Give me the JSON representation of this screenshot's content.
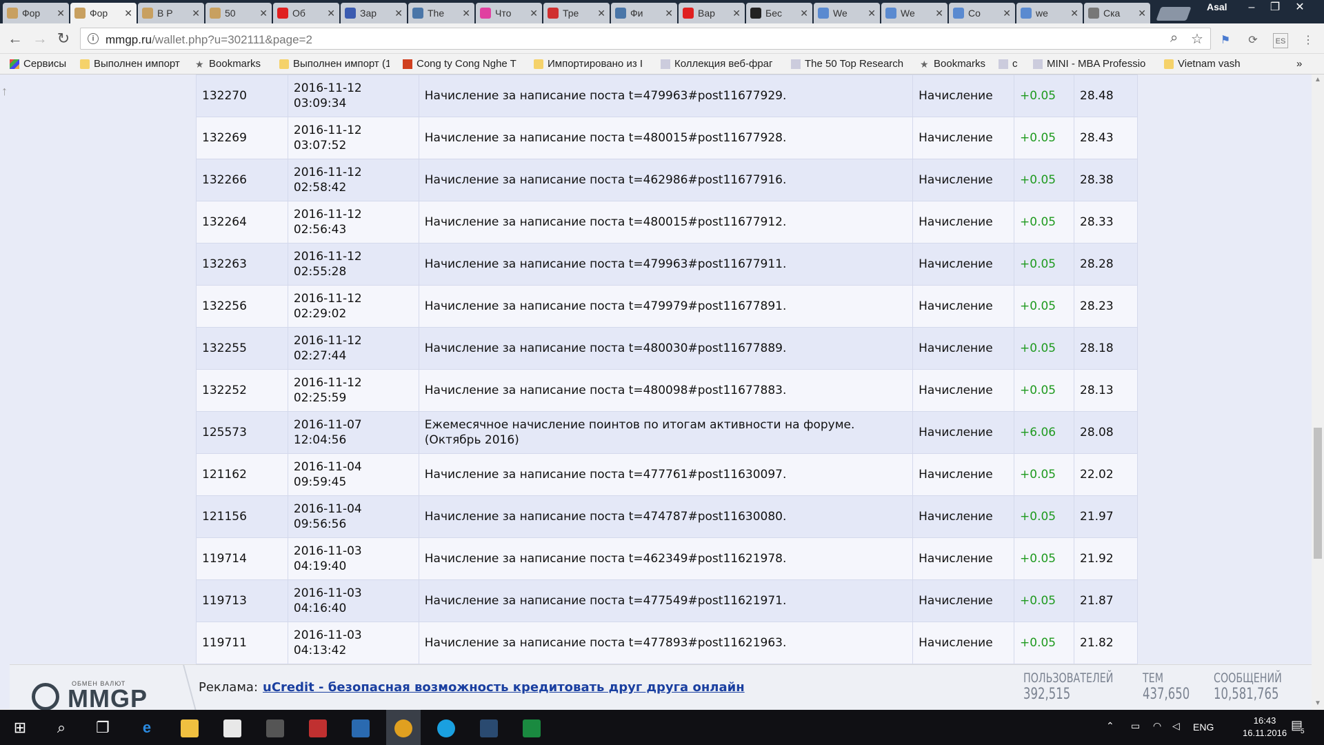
{
  "tabs": [
    {
      "label": "Фор",
      "favicon_color": "#c8a060"
    },
    {
      "label": "Фор",
      "favicon_color": "#c8a060",
      "active": true
    },
    {
      "label": "В Р",
      "favicon_color": "#c8a060"
    },
    {
      "label": "50",
      "favicon_color": "#c8a060"
    },
    {
      "label": "Об",
      "favicon_color": "#e02020"
    },
    {
      "label": "Зар",
      "favicon_color": "#3b5bb0"
    },
    {
      "label": "The",
      "favicon_color": "#4a76a8"
    },
    {
      "label": "Что",
      "favicon_color": "#e040a0"
    },
    {
      "label": "Тре",
      "favicon_color": "#d03030"
    },
    {
      "label": "Фи",
      "favicon_color": "#4a76a8"
    },
    {
      "label": "Вар",
      "favicon_color": "#e02020"
    },
    {
      "label": "Бес",
      "favicon_color": "#222222"
    },
    {
      "label": "We",
      "favicon_color": "#5a8ad0"
    },
    {
      "label": "We",
      "favicon_color": "#5a8ad0"
    },
    {
      "label": "Co",
      "favicon_color": "#5a8ad0"
    },
    {
      "label": "we",
      "favicon_color": "#5a8ad0"
    },
    {
      "label": "Ска",
      "favicon_color": "#777777"
    }
  ],
  "profile_name": "Asal",
  "window_controls": {
    "minimize": "–",
    "restore": "❐",
    "close": "✕"
  },
  "address_bar": {
    "domain": "mmgp.ru",
    "path": "/wallet.php?u=302111&page=2"
  },
  "bookmarks": [
    {
      "label": "Сервисы",
      "icon": "apps-icon"
    },
    {
      "label": "Выполнен импорт",
      "icon": "folder-icon"
    },
    {
      "label": "Bookmarks",
      "icon": "star-icon"
    },
    {
      "label": "Выполнен импорт (1",
      "icon": "folder-icon"
    },
    {
      "label": "Cong ty Cong Nghe T",
      "icon": "scn-icon"
    },
    {
      "label": "Импортировано из I",
      "icon": "folder-icon"
    },
    {
      "label": "Коллекция веб-фраг",
      "icon": "page-icon"
    },
    {
      "label": "The 50 Top Research",
      "icon": "page-icon"
    },
    {
      "label": "Bookmarks",
      "icon": "star-icon"
    },
    {
      "label": "c",
      "icon": "page-icon"
    },
    {
      "label": "MINI - MBA Professio",
      "icon": "page-icon"
    },
    {
      "label": "Vietnam vash",
      "icon": "folder-icon"
    }
  ],
  "wallet_rows": [
    {
      "id": "132270",
      "date": "2016-11-12",
      "time": "03:09:34",
      "desc": "Начисление за написание поста t=479963#post11677929.",
      "type": "Начисление",
      "amount": "+0.05",
      "balance": "28.48"
    },
    {
      "id": "132269",
      "date": "2016-11-12",
      "time": "03:07:52",
      "desc": "Начисление за написание поста t=480015#post11677928.",
      "type": "Начисление",
      "amount": "+0.05",
      "balance": "28.43"
    },
    {
      "id": "132266",
      "date": "2016-11-12",
      "time": "02:58:42",
      "desc": "Начисление за написание поста t=462986#post11677916.",
      "type": "Начисление",
      "amount": "+0.05",
      "balance": "28.38"
    },
    {
      "id": "132264",
      "date": "2016-11-12",
      "time": "02:56:43",
      "desc": "Начисление за написание поста t=480015#post11677912.",
      "type": "Начисление",
      "amount": "+0.05",
      "balance": "28.33"
    },
    {
      "id": "132263",
      "date": "2016-11-12",
      "time": "02:55:28",
      "desc": "Начисление за написание поста t=479963#post11677911.",
      "type": "Начисление",
      "amount": "+0.05",
      "balance": "28.28"
    },
    {
      "id": "132256",
      "date": "2016-11-12",
      "time": "02:29:02",
      "desc": "Начисление за написание поста t=479979#post11677891.",
      "type": "Начисление",
      "amount": "+0.05",
      "balance": "28.23"
    },
    {
      "id": "132255",
      "date": "2016-11-12",
      "time": "02:27:44",
      "desc": "Начисление за написание поста t=480030#post11677889.",
      "type": "Начисление",
      "amount": "+0.05",
      "balance": "28.18"
    },
    {
      "id": "132252",
      "date": "2016-11-12",
      "time": "02:25:59",
      "desc": "Начисление за написание поста t=480098#post11677883.",
      "type": "Начисление",
      "amount": "+0.05",
      "balance": "28.13"
    },
    {
      "id": "125573",
      "date": "2016-11-07",
      "time": "12:04:56",
      "desc": "Ежемесячное начисление поинтов по итогам активности на форуме. (Октябрь 2016)",
      "type": "Начисление",
      "amount": "+6.06",
      "balance": "28.08"
    },
    {
      "id": "121162",
      "date": "2016-11-04",
      "time": "09:59:45",
      "desc": "Начисление за написание поста t=477761#post11630097.",
      "type": "Начисление",
      "amount": "+0.05",
      "balance": "22.02"
    },
    {
      "id": "121156",
      "date": "2016-11-04",
      "time": "09:56:56",
      "desc": "Начисление за написание поста t=474787#post11630080.",
      "type": "Начисление",
      "amount": "+0.05",
      "balance": "21.97"
    },
    {
      "id": "119714",
      "date": "2016-11-03",
      "time": "04:19:40",
      "desc": "Начисление за написание поста t=462349#post11621978.",
      "type": "Начисление",
      "amount": "+0.05",
      "balance": "21.92"
    },
    {
      "id": "119713",
      "date": "2016-11-03",
      "time": "04:16:40",
      "desc": "Начисление за написание поста t=477549#post11621971.",
      "type": "Начисление",
      "amount": "+0.05",
      "balance": "21.87"
    },
    {
      "id": "119711",
      "date": "2016-11-03",
      "time": "04:13:42",
      "desc": "Начисление за написание поста t=477893#post11621963.",
      "type": "Начисление",
      "amount": "+0.05",
      "balance": "21.82"
    }
  ],
  "footer": {
    "logo_subtitle": "ОБМЕН ВАЛЮТ",
    "logo_text": "MMGP",
    "ad_label": "Реклама:",
    "ad_link": "uCredit - безопасная возможность кредитовать друг друга онлайн",
    "stats": [
      {
        "label": "ПОЛЬЗОВАТЕЛЕЙ",
        "value": "392,515"
      },
      {
        "label": "ТЕМ",
        "value": "437,650"
      },
      {
        "label": "СООБЩЕНИЙ",
        "value": "10,581,765"
      }
    ]
  },
  "taskbar": {
    "apps": [
      "start-icon",
      "search-icon",
      "task-view-icon",
      "edge-icon",
      "file-explorer-icon",
      "store-icon",
      "app-icon",
      "app-icon",
      "app-icon",
      "chrome-icon",
      "skype-icon",
      "app-icon",
      "app-icon"
    ],
    "language": "ENG",
    "time": "16:43",
    "date": "16.11.2016",
    "notifications": "5"
  },
  "colors": {
    "amount_positive": "#1f9a1f",
    "link": "#1a3fa0",
    "page_bg": "#e8ebf7"
  }
}
